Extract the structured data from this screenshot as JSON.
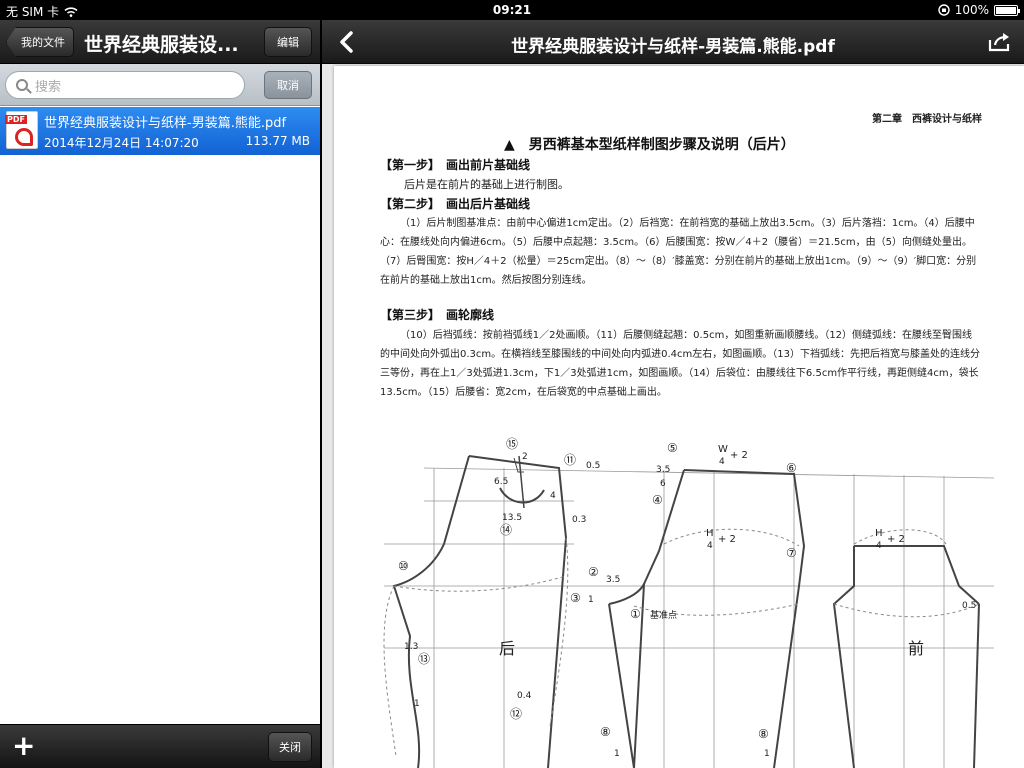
{
  "status": {
    "carrier": "无 SIM 卡",
    "time": "09:21",
    "battery": "100%"
  },
  "left": {
    "back_label": "我的文件",
    "title": "世界经典服装设...",
    "edit_label": "编辑",
    "search_placeholder": "搜索",
    "cancel_label": "取消",
    "file": {
      "icon_tag": "PDF",
      "name": "世界经典服装设计与纸样-男装篇.熊能.pdf",
      "date": "2014年12月24日 14:07:20",
      "size": "113.77 MB"
    },
    "close_label": "关闭",
    "add_icon": "+"
  },
  "viewer": {
    "title": "世界经典服装设计与纸样-男装篇.熊能.pdf"
  },
  "document": {
    "chapter": "第二章　西裤设计与纸样",
    "heading": "▲　男西裤基本型纸样制图步骤及说明（后片）",
    "step1": "【第一步】　画出前片基础线",
    "step1_text": "后片是在前片的基础上进行制图。",
    "step2": "【第二步】　画出后片基础线",
    "step2_text": "（1）后片制图基准点：由前中心偏进1cm定出。（2）后裆宽：在前裆宽的基础上放出3.5cm。（3）后片落裆：1cm。（4）后腰中心：在腰线处向内偏进6cm。（5）后腰中点起翘：3.5cm。（6）后腰围宽：按W／4＋2（腰省）＝21.5cm，由（5）向侧缝处量出。（7）后臀围宽：按H／4＋2（松量）＝25cm定出。（8）～（8）′膝盖宽：分别在前片的基础上放出1cm。（9）～（9）′脚口宽：分别在前片的基础上放出1cm。然后按图分别连线。",
    "step3": "【第三步】　画轮廓线",
    "step3_text": "（10）后裆弧线：按前裆弧线1／2处画顺。（11）后腰侧缝起翘：0.5cm，如图重新画顺腰线。（12）侧缝弧线：在腰线至臀围线的中间处向外弧出0.3cm。在横裆线至膝围线的中间处向内弧进0.4cm左右，如图画顺。（13）下裆弧线：先把后裆宽与膝盖处的连线分三等份，再在上1／3处弧进1.3cm，下1／3处弧进1cm，如图画顺。（14）后袋位：由腰线往下6.5cm作平行线，再距侧缝4cm，袋长13.5cm。（15）后腰省：宽2cm，在后袋宽的中点基础上画出。"
  },
  "diagram": {
    "labels": {
      "back": "后",
      "front": "前",
      "base_point": "基准点",
      "n15": "⑮",
      "n11": "⑪",
      "n10": "⑩",
      "n13": "⑬",
      "n12": "⑫",
      "n14": "⑭",
      "n5": "⑤",
      "n4": "④",
      "n6": "⑥",
      "n7": "⑦",
      "n2": "②",
      "n3": "③",
      "n1": "①",
      "n8": "⑧",
      "n8b": "⑧",
      "v2": "2",
      "v05a": "0.5",
      "v65": "6.5",
      "v4": "4",
      "v135": "13.5",
      "v03": "0.3",
      "v13": "1.3",
      "v1a": "1",
      "v04": "0.4",
      "v35a": "3.5",
      "v6": "6",
      "v35b": "3.5",
      "v1b": "1",
      "v1c": "1",
      "v1d": "1",
      "v05b": "0.5",
      "w4": "W",
      "w4den": "4",
      "w4plus": "+ 2",
      "h4": "H",
      "h4den": "4",
      "h4plus": "+ 2",
      "h4b": "H",
      "h4bden": "4",
      "h4bplus": "+ 2"
    }
  }
}
